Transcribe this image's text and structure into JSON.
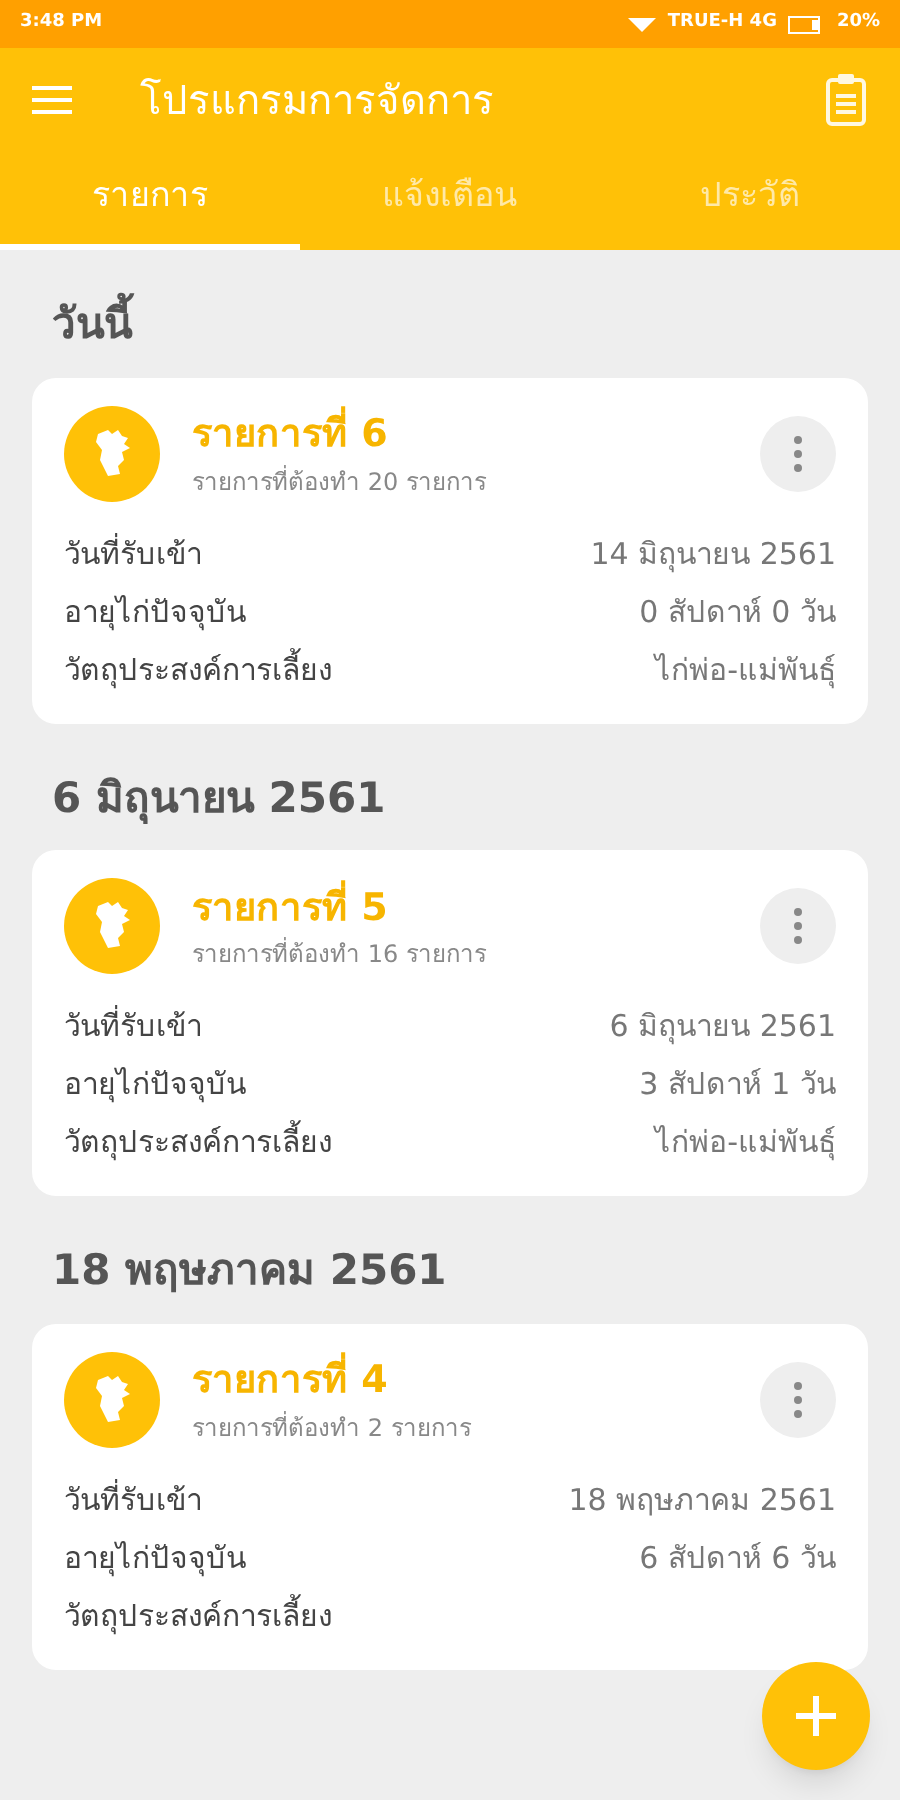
{
  "status_bar": {
    "time": "3:48 PM",
    "carrier": "TRUE-H 4G",
    "battery": "20%"
  },
  "app_bar": {
    "title": "โปรแกรมการจัดการ"
  },
  "tabs": [
    {
      "label": "รายการ",
      "selected": true
    },
    {
      "label": "แจ้งเตือน",
      "selected": false
    },
    {
      "label": "ประวัติ",
      "selected": false
    }
  ],
  "sections": [
    {
      "heading": "วันนี้",
      "cards": [
        {
          "title": "รายการที่ 6",
          "subtitle": "รายการที่ต้องทำ 20 รายการ",
          "rows": [
            {
              "label": "วันที่รับเข้า",
              "value": "14 มิถุนายน 2561"
            },
            {
              "label": "อายุไก่ปัจจุบัน",
              "value": "0 สัปดาห์ 0 วัน"
            },
            {
              "label": "วัตถุประสงค์การเลี้ยง",
              "value": "ไก่พ่อ-แม่พันธุ์"
            }
          ]
        }
      ]
    },
    {
      "heading": "6 มิถุนายน 2561",
      "cards": [
        {
          "title": "รายการที่ 5",
          "subtitle": "รายการที่ต้องทำ 16 รายการ",
          "rows": [
            {
              "label": "วันที่รับเข้า",
              "value": "6 มิถุนายน 2561"
            },
            {
              "label": "อายุไก่ปัจจุบัน",
              "value": "3 สัปดาห์ 1 วัน"
            },
            {
              "label": "วัตถุประสงค์การเลี้ยง",
              "value": "ไก่พ่อ-แม่พันธุ์"
            }
          ]
        }
      ]
    },
    {
      "heading": "18 พฤษภาคม 2561",
      "cards": [
        {
          "title": "รายการที่ 4",
          "subtitle": "รายการที่ต้องทำ 2 รายการ",
          "rows": [
            {
              "label": "วันที่รับเข้า",
              "value": "18 พฤษภาคม 2561"
            },
            {
              "label": "อายุไก่ปัจจุบัน",
              "value": "6 สัปดาห์ 6 วัน"
            },
            {
              "label": "วัตถุประสงค์การเลี้ยง"
            }
          ]
        }
      ]
    }
  ]
}
